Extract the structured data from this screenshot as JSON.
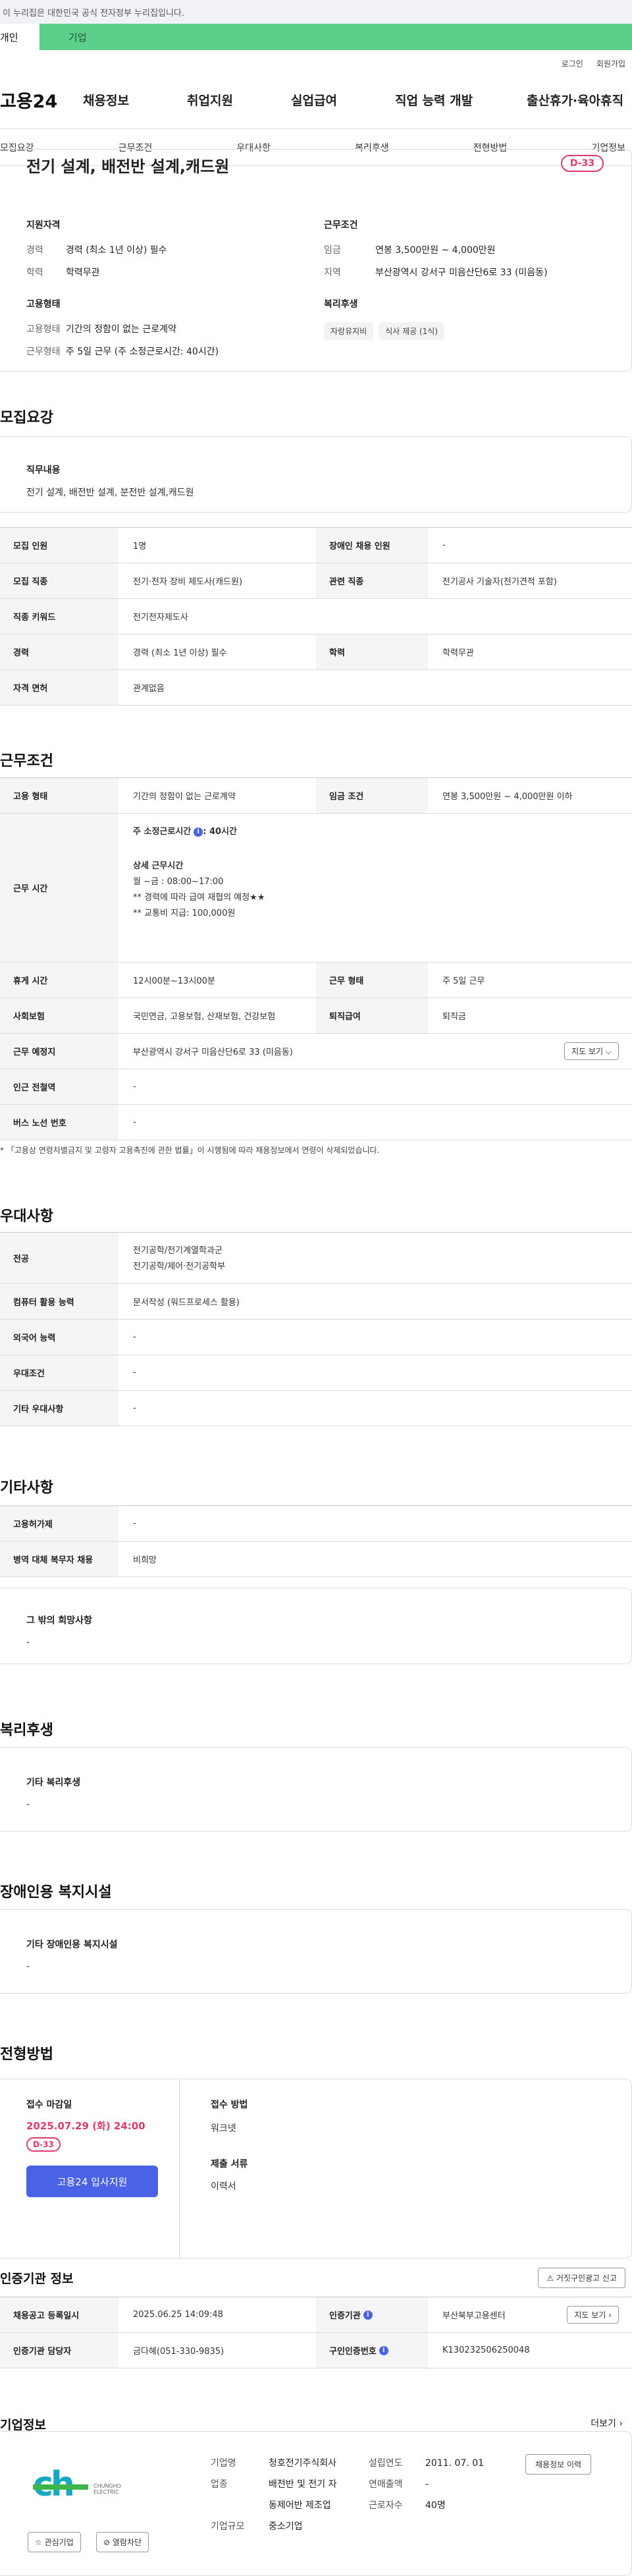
{
  "gov_banner": "이 누리집은 대한민국 공식 전자정부 누리집입니다.",
  "user_tabs": {
    "personal": "개인",
    "company": "기업"
  },
  "util": {
    "login": "로그인",
    "join": "회원가입"
  },
  "logo": "고용24",
  "gnb": [
    "채용정보",
    "취업지원",
    "실업급여",
    "직업 능력 개발",
    "출산휴가·육아휴직"
  ],
  "tabs": [
    "모집요강",
    "근무조건",
    "우대사항",
    "복리후생",
    "전형방법",
    "기업정보"
  ],
  "summary": {
    "title": "전기 설계, 배전반 설계,캐드원",
    "dday": "D-33",
    "qual_head": "지원자격",
    "qual": [
      {
        "k": "경력",
        "v": "경력 (최소 1년 이상) 필수"
      },
      {
        "k": "학력",
        "v": "학력무관"
      }
    ],
    "cond_head": "근무조건",
    "cond": [
      {
        "k": "임금",
        "v": "연봉 3,500만원 ~ 4,000만원"
      },
      {
        "k": "지역",
        "v": "부산광역시 강서구 미음산단6로 33 (미음동)"
      }
    ],
    "emp_head": "고용형태",
    "emp": [
      {
        "k": "고용형태",
        "v": "기간의 정함이 없는 근로계약"
      },
      {
        "k": "근무형태",
        "v": "주 5일 근무 (주 소정근로시간: 40시간)"
      }
    ],
    "welfare_head": "복리후생",
    "welfare_tags": [
      "자랑유지비",
      "식사 제공 (1식)"
    ]
  },
  "recruit": {
    "title": "모집요강",
    "duty_head": "직무내용",
    "duty_body": "전기 설계, 배전반 설계, 분전반 설계,캐드원",
    "rows": [
      {
        "k1": "모집 인원",
        "v1": "1명",
        "k2": "장애인 채용 인원",
        "v2": "-"
      },
      {
        "k1": "모집 직종",
        "v1": "전기·전자 장비 제도사(캐드원)",
        "k2": "관련 직종",
        "v2": "전기공사 기술자(전기견적 포함)"
      },
      {
        "k1": "직종 키워드",
        "v1": "전기전자제도사"
      },
      {
        "k1": "경력",
        "v1": "경력 (최소 1년 이상) 필수",
        "k2": "학력",
        "v2": "학력무관"
      },
      {
        "k1": "자격 면허",
        "v1": "관계없음"
      }
    ]
  },
  "work": {
    "title": "근무조건",
    "emp_type_k": "고용 형태",
    "emp_type_v": "기간의 정함이 없는 근로계약",
    "wage_k": "임금 조건",
    "wage_v": "연봉 3,500만원 ~ 4,000만원 이하",
    "hours_k": "근무 시간",
    "hours_main_prefix": "주 소정근로시간",
    "hours_main_value": ": 40시간",
    "hours_detail_head": "상세 근무시간",
    "hours_lines": [
      "월 ~금 : 08:00~17:00",
      "** 경력에 따라 급여 재협의 예정★★",
      "** 교통비 지급: 100,000원"
    ],
    "break_k": "휴게 시간",
    "break_v": "12시00분~13시00분",
    "shape_k": "근무 형태",
    "shape_v": "주 5일 근무",
    "ins_k": "사회보험",
    "ins_v": "국민연금, 고용보험, 산재보험, 건강보험",
    "retire_k": "퇴직급여",
    "retire_v": "퇴직금",
    "loc_k": "근무 예정지",
    "loc_v": "부산광역시 강서구 미음산단6로 33 (미음동)",
    "map_btn": "지도 보기",
    "subway_k": "인근 전철역",
    "subway_v": "-",
    "bus_k": "버스 노선 번호",
    "bus_v": "-",
    "note": "「고용상 연령차별금지 및 고령자 고용촉진에 관한 법률」이 시행됨에 따라 채용정보에서 연령이 삭제되었습니다."
  },
  "pref": {
    "title": "우대사항",
    "rows": [
      {
        "k": "전공",
        "v": [
          "전기공학/전기계열학과군",
          "전기공학/제어·전기공학부"
        ]
      },
      {
        "k": "컴퓨터 활용 능력",
        "v": [
          "문서작성 (워드프로세스 활용)"
        ]
      },
      {
        "k": "외국어 능력",
        "v": [
          "-"
        ]
      },
      {
        "k": "우대조건",
        "v": [
          "-"
        ]
      },
      {
        "k": "기타 우대사항",
        "v": [
          "-"
        ]
      }
    ]
  },
  "etc": {
    "title": "기타사항",
    "rows": [
      {
        "k": "고용허가제",
        "v": "-"
      },
      {
        "k": "병역 대체 복무자 채용",
        "v": "비희망"
      }
    ],
    "other_head": "그 밖의 희망사항",
    "other_body": "-"
  },
  "welfare": {
    "title": "복리후생",
    "head": "기타 복리후생",
    "body": "-"
  },
  "disability": {
    "title": "장애인용 복지시설",
    "head": "기타 장애인용 복지시설",
    "body": "-"
  },
  "selection": {
    "title": "전형방법",
    "deadline_head": "접수 마감일",
    "deadline": "2025.07.29 (화) 24:00",
    "dday": "D-33",
    "apply_btn": "고용24 입사지원",
    "method_head": "접수 방법",
    "method": "워크넷",
    "docs_head": "제출 서류",
    "docs": "이력서"
  },
  "cert": {
    "title": "인증기관 정보",
    "report_btn": "거짓구인광고 신고",
    "rows": [
      {
        "k1": "채용공고 등록일시",
        "v1": "2025.06.25 14:09:48",
        "k2": "인증기관",
        "v2": "부산북부고용센터",
        "btn": "지도 보기"
      },
      {
        "k1": "인증기관 담당자",
        "v1": "금다혜(051-330-9835)",
        "k2": "구인인증번호",
        "v2": "K130232506250048"
      }
    ]
  },
  "company": {
    "title": "기업정보",
    "more": "더보기",
    "logo_text": "ch",
    "logo_sub": "CHUNGHO ELECTRIC",
    "fav_btn": "관심기업",
    "block_btn": "열람차단",
    "name_k": "기업명",
    "name_v": "청호전기주식회사",
    "ind_k": "업종",
    "ind_v": [
      "배전반 및 전기 자",
      "동제어반 제조업"
    ],
    "size_k": "기업규모",
    "size_v": "중소기업",
    "est_k": "설립연도",
    "est_v": "2011. 07. 01",
    "sales_k": "연매출액",
    "sales_v": "-",
    "emp_k": "근로자수",
    "emp_v": "40명",
    "jobs_btn": "채용정보 이력"
  },
  "colors": {
    "accent": "#4a63e6",
    "dday": "#e03a6a",
    "company_tab": "#5ccf8a"
  }
}
